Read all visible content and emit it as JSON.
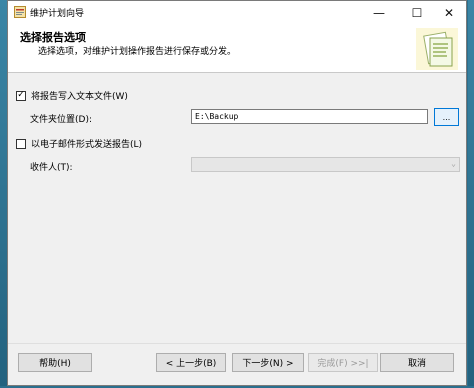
{
  "window": {
    "title": "维护计划向导"
  },
  "titlebar_buttons": {
    "minimize": "—",
    "maximize": "☐",
    "close": "✕"
  },
  "header": {
    "title": "选择报告选项",
    "subtitle": "选择选项，对维护计划操作报告进行保存或分发。"
  },
  "report_file": {
    "checkbox_label": "将报告写入文本文件(W)",
    "checked": true,
    "check_glyph": "✓",
    "folder_label": "文件夹位置(D):",
    "folder_value": "E:\\Backup",
    "browse_label": "..."
  },
  "email": {
    "checkbox_label": "以电子邮件形式发送报告(L)",
    "checked": false,
    "recipient_label": "收件人(T):",
    "recipient_value": ""
  },
  "footer": {
    "help": "帮助(H)",
    "back": "< 上一步(B)",
    "next": "下一步(N) >",
    "finish": "完成(F) >>|",
    "cancel": "取消"
  }
}
